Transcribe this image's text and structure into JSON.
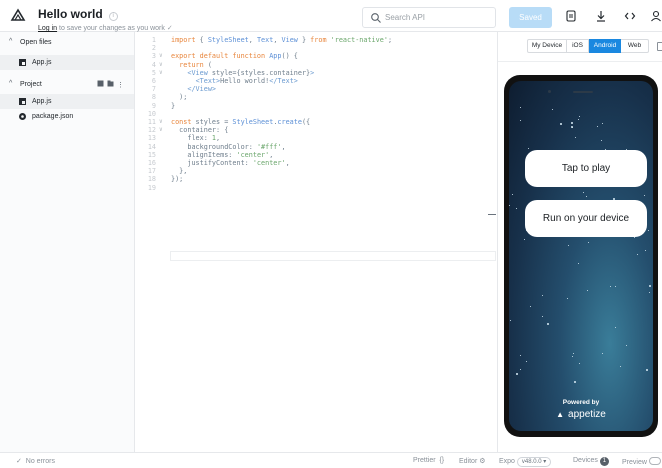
{
  "header": {
    "title": "Hello world",
    "info_glyph": "i",
    "login_link": "Log in",
    "subtitle_rest": " to save your changes as you work",
    "check_glyph": "✓",
    "search_placeholder": "Search API",
    "saved_label": "Saved",
    "icons": [
      "snack-logo-icon",
      "info-icon",
      "search-icon",
      "qr-code-icon",
      "download-icon",
      "embed-code-icon",
      "user-icon"
    ]
  },
  "sidebar": {
    "open_files_label": "Open files",
    "open_files": [
      {
        "name": "App.js",
        "icon": "file-js-icon"
      }
    ],
    "project_label": "Project",
    "project_files": [
      {
        "name": "App.js",
        "icon": "file-js-icon"
      },
      {
        "name": "package.json",
        "icon": "package-icon"
      }
    ],
    "chevron": "^"
  },
  "editor": {
    "lines": [
      {
        "n": "1",
        "fold": "",
        "code": [
          [
            "kw",
            "import"
          ],
          [
            "txt",
            " { "
          ],
          [
            "fn",
            "StyleSheet"
          ],
          [
            "txt",
            ", "
          ],
          [
            "fn",
            "Text"
          ],
          [
            "txt",
            ", "
          ],
          [
            "fn",
            "View"
          ],
          [
            "txt",
            " } "
          ],
          [
            "kw",
            "from"
          ],
          [
            "txt",
            " "
          ],
          [
            "st",
            "'react-native'"
          ],
          [
            "txt",
            ";"
          ]
        ]
      },
      {
        "n": "2",
        "fold": "",
        "code": []
      },
      {
        "n": "3",
        "fold": "∨",
        "code": [
          [
            "kw",
            "export default function"
          ],
          [
            "txt",
            " "
          ],
          [
            "fn",
            "App"
          ],
          [
            "txt",
            "() {"
          ]
        ]
      },
      {
        "n": "4",
        "fold": "∨",
        "code": [
          [
            "txt",
            "  "
          ],
          [
            "kw",
            "return"
          ],
          [
            "txt",
            " ("
          ]
        ]
      },
      {
        "n": "5",
        "fold": "∨",
        "code": [
          [
            "txt",
            "    "
          ],
          [
            "tg",
            "<View"
          ],
          [
            "txt",
            " style={styles.container}"
          ],
          [
            "tg",
            ">"
          ]
        ]
      },
      {
        "n": "6",
        "fold": "",
        "code": [
          [
            "txt",
            "      "
          ],
          [
            "tg",
            "<Text>"
          ],
          [
            "txt",
            "Hello world!"
          ],
          [
            "tg",
            "</Text>"
          ]
        ]
      },
      {
        "n": "7",
        "fold": "",
        "code": [
          [
            "txt",
            "    "
          ],
          [
            "tg",
            "</View>"
          ]
        ]
      },
      {
        "n": "8",
        "fold": "",
        "code": [
          [
            "txt",
            "  );"
          ]
        ]
      },
      {
        "n": "9",
        "fold": "",
        "code": [
          [
            "txt",
            "}"
          ]
        ]
      },
      {
        "n": "10",
        "fold": "",
        "code": []
      },
      {
        "n": "11",
        "fold": "∨",
        "code": [
          [
            "kw",
            "const"
          ],
          [
            "txt",
            " styles = "
          ],
          [
            "fn",
            "StyleSheet"
          ],
          [
            "txt",
            "."
          ],
          [
            "fn",
            "create"
          ],
          [
            "txt",
            "({"
          ]
        ]
      },
      {
        "n": "12",
        "fold": "∨",
        "code": [
          [
            "txt",
            "  container: {"
          ]
        ]
      },
      {
        "n": "13",
        "fold": "",
        "code": [
          [
            "txt",
            "    flex: "
          ],
          [
            "st",
            "1"
          ],
          [
            "txt",
            ","
          ]
        ]
      },
      {
        "n": "14",
        "fold": "",
        "code": [
          [
            "txt",
            "    backgroundColor: "
          ],
          [
            "st",
            "'#fff'"
          ],
          [
            "txt",
            ","
          ]
        ]
      },
      {
        "n": "15",
        "fold": "",
        "code": [
          [
            "txt",
            "    alignItems: "
          ],
          [
            "st",
            "'center'"
          ],
          [
            "txt",
            ","
          ]
        ]
      },
      {
        "n": "16",
        "fold": "",
        "code": [
          [
            "txt",
            "    justifyContent: "
          ],
          [
            "st",
            "'center'"
          ],
          [
            "txt",
            ","
          ]
        ]
      },
      {
        "n": "17",
        "fold": "",
        "code": [
          [
            "txt",
            "  },"
          ]
        ]
      },
      {
        "n": "18",
        "fold": "",
        "code": [
          [
            "txt",
            "});"
          ]
        ]
      },
      {
        "n": "19",
        "fold": "",
        "code": []
      }
    ]
  },
  "preview": {
    "device_tabs": [
      {
        "label": "My Device",
        "active": false
      },
      {
        "label": "iOS",
        "active": false
      },
      {
        "label": "Android",
        "active": true
      },
      {
        "label": "Web",
        "active": false
      }
    ],
    "tap_to_play": "Tap to play",
    "run_on_device": "Run on your device",
    "powered_by": "Powered by",
    "appetize": "appetize",
    "appetize_glyph": "▲"
  },
  "footer": {
    "status_glyph": "✓",
    "status": "No errors",
    "prettier": "Prettier",
    "prettier_glyph": "{}",
    "editor": "Editor",
    "editor_glyph": "⚙",
    "expo": "Expo",
    "expo_version": "v48.0.0 ▾",
    "devices": "Devices",
    "devices_count": "1",
    "preview": "Preview"
  },
  "colors": {
    "accent": "#1a88e0",
    "saved_button": "#b8dcf7",
    "keyword": "#e8853b",
    "function": "#5b8fd6",
    "string": "#6aa66b"
  }
}
